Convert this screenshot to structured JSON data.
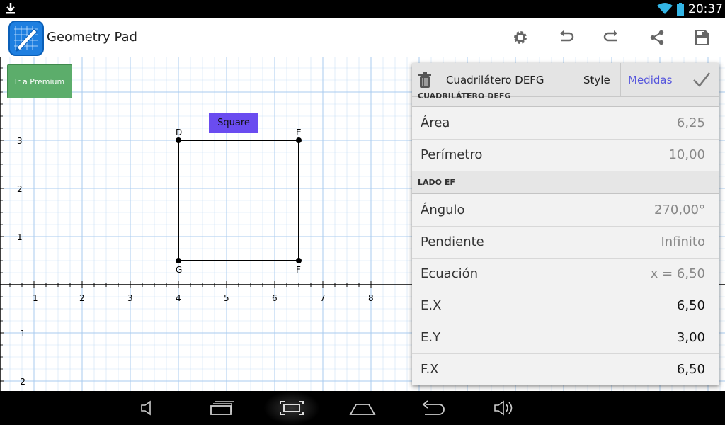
{
  "status": {
    "time": "20:37"
  },
  "app": {
    "title": "Geometry Pad"
  },
  "actions": [
    "settings-icon",
    "undo-icon",
    "redo-icon",
    "share-icon",
    "save-icon"
  ],
  "canvas": {
    "premium_label": "Ir a Premium",
    "shape_label": "Square",
    "x_ticks": [
      "1",
      "2",
      "3",
      "4",
      "5",
      "6",
      "7",
      "8"
    ],
    "y_ticks": [
      "3",
      "2",
      "1",
      "-1",
      "-2"
    ],
    "points": [
      {
        "name": "D",
        "x": 4,
        "y": 3
      },
      {
        "name": "E",
        "x": 6.5,
        "y": 3
      },
      {
        "name": "F",
        "x": 6.5,
        "y": 0.5
      },
      {
        "name": "G",
        "x": 4,
        "y": 0.5
      }
    ]
  },
  "panel": {
    "title": "Cuadrilátero DEFG",
    "style_tab": "Style",
    "measures_tab": "Medidas",
    "section1_cut": "CUADRILÁTERO DEFG",
    "section2": "LADO EF",
    "rows": [
      {
        "key": "Área",
        "value": "6,25"
      },
      {
        "key": "Perímetro",
        "value": "10,00"
      },
      {
        "key": "Ángulo",
        "value": "270,00°"
      },
      {
        "key": "Pendiente",
        "value": "Infinito"
      },
      {
        "key": "Ecuación",
        "value": "x = 6,50"
      },
      {
        "key": "E.X",
        "value": "6,50"
      },
      {
        "key": "E.Y",
        "value": "3,00"
      },
      {
        "key": "F.X",
        "value": "6,50"
      }
    ]
  },
  "colors": {
    "accent": "#5555dd",
    "premium": "#5cad6b",
    "shape_label_bg": "#6a4cf0",
    "grid": "#a8cbef"
  }
}
